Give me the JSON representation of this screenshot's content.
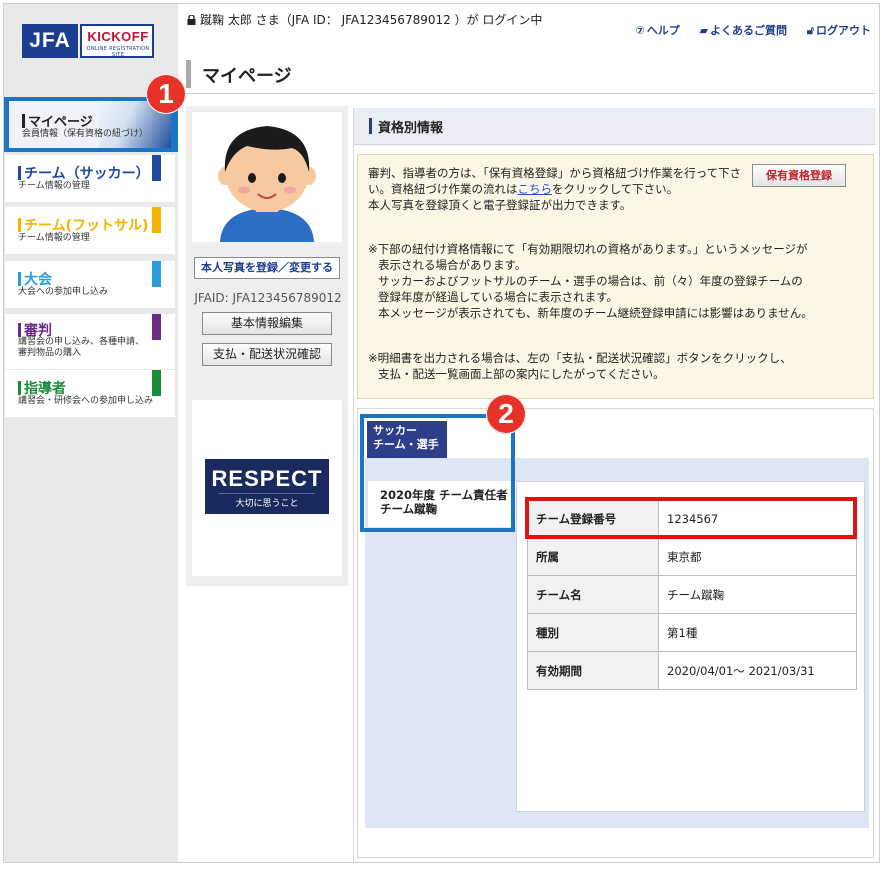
{
  "logo": {
    "brand": "JFA",
    "product": "KICKOFF",
    "tagline": "ONLINE REGISTRATION SITE"
  },
  "header": {
    "user_line": "蹴鞠 太郎 さま（JFA ID： JFA123456789012 ）が ログイン中",
    "links": [
      {
        "icon": "help-icon",
        "label": "ヘルプ"
      },
      {
        "icon": "faq-icon",
        "label": "よくあるご質問"
      },
      {
        "icon": "logout-icon",
        "label": "ログアウト"
      }
    ]
  },
  "page_title": "マイページ",
  "sidebar": {
    "items": [
      {
        "title": "マイページ",
        "sub": "会員情報（保有資格の紐づけ）",
        "color": "#1a3d8f"
      },
      {
        "title": "チーム（サッカー）",
        "sub": "チーム情報の管理",
        "color": "#1f4aa0"
      },
      {
        "title": "チーム(フットサル)",
        "sub": "チーム情報の管理",
        "color": "#f2b400"
      },
      {
        "title": "大会",
        "sub": "大会への参加申し込み",
        "color": "#2a9ed8"
      },
      {
        "title": "審判",
        "sub1": "講習会の申し込み、各種申請、",
        "sub2": "審判物品の購入",
        "color": "#6b2a84"
      },
      {
        "title": "指導者",
        "sub": "講習会・研修会への参加申し込み",
        "color": "#1b8a3a"
      }
    ]
  },
  "profile": {
    "photo_button": "本人写真を登録／変更する",
    "jfaid": "JFAID: JFA123456789012",
    "basic_info_button": "基本情報編集",
    "payment_button": "支払・配送状況確認",
    "respect_title": "RESPECT",
    "respect_sub": "大切に思うこと"
  },
  "section_title": "資格別情報",
  "notice": {
    "line1a": "審判、指導者の方は、「保有資格登録」から資格紐づけ作業を行って下さい。資格紐づけ作業の流れは",
    "link": "こちら",
    "line1b": "をクリックして下さい。",
    "line1c": "本人写真を登録頂くと電子登録証が出力できます。",
    "holding_button": "保有資格登録",
    "p2_1": "※下部の紐付け資格情報にて「有効期限切れの資格があります。」というメッセージが",
    "p2_2": "表示される場合があります。",
    "p2_3": "サッカーおよびフットサルのチーム・選手の場合は、前（々）年度の登録チームの",
    "p2_4": "登録年度が経過している場合に表示されます。",
    "p2_5": "本メッセージが表示されても、新年度のチーム継続登録申請には影響はありません。",
    "p3_1": "※明細書を出力される場合は、左の「支払・配送状況確認」ボタンをクリックし、",
    "p3_2": "支払・配送一覧画面上部の案内にしたがってください。"
  },
  "qualification": {
    "tab_line1": "サッカー",
    "tab_line2": "チーム・選手",
    "role_line1": "2020年度 チーム責任者",
    "role_line2": "チーム蹴鞠",
    "rows": [
      {
        "label": "チーム登録番号",
        "value": "1234567"
      },
      {
        "label": "所属",
        "value": "東京都"
      },
      {
        "label": "チーム名",
        "value": "チーム蹴鞠"
      },
      {
        "label": "種別",
        "value": "第1種"
      },
      {
        "label": "有効期間",
        "value": "2020/04/01～ 2021/03/31"
      }
    ]
  },
  "badges": {
    "first": "1",
    "second": "2"
  }
}
